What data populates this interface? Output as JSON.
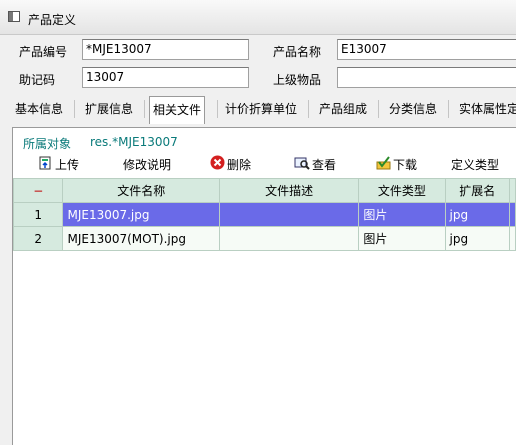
{
  "window": {
    "title": "产品定义"
  },
  "form": {
    "code_label": "产品编号",
    "code_value": "*MJE13007",
    "name_label": "产品名称",
    "name_value": "E13007",
    "mnemonic_label": "助记码",
    "mnemonic_value": "13007",
    "parent_label": "上级物品",
    "parent_value": ""
  },
  "tabs": [
    {
      "label": "基本信息"
    },
    {
      "label": "扩展信息"
    },
    {
      "label": "相关文件",
      "active": true
    },
    {
      "label": "计价折算单位"
    },
    {
      "label": "产品组成"
    },
    {
      "label": "分类信息"
    },
    {
      "label": "实体属性定"
    }
  ],
  "owner": {
    "label": "所属对象",
    "value": "res.*MJE13007"
  },
  "toolbar": {
    "upload": "上传",
    "edit_note": "修改说明",
    "delete": "删除",
    "view": "查看",
    "download": "下载",
    "define_type": "定义类型"
  },
  "grid": {
    "corner": "−",
    "columns": [
      "文件名称",
      "文件描述",
      "文件类型",
      "扩展名"
    ],
    "rows": [
      {
        "num": "1",
        "name": "MJE13007.jpg",
        "desc": "",
        "type": "图片",
        "ext": "jpg",
        "selected": true
      },
      {
        "num": "2",
        "name": "MJE13007(MOT).jpg",
        "desc": "",
        "type": "图片",
        "ext": "jpg",
        "selected": false
      }
    ]
  },
  "colors": {
    "selection": "#6a6ae8",
    "header": "#d6eadf",
    "owner_text": "#0a7a7a"
  }
}
